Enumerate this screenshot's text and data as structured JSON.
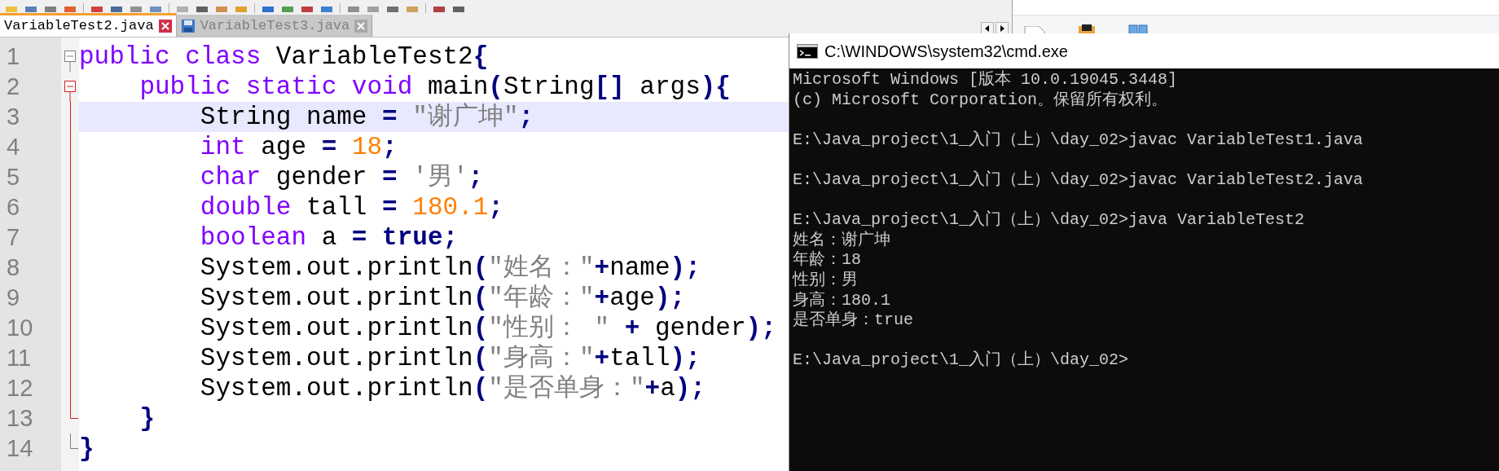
{
  "editor": {
    "tabs": [
      {
        "label": "VariableTest2.java",
        "selected": true
      },
      {
        "label": "VariableTest3.java",
        "selected": false
      }
    ],
    "lines": [
      {
        "number": "1",
        "kind": "fold_start",
        "current": false,
        "tokens": [
          {
            "kind": "keyword",
            "text": "public class"
          },
          {
            "kind": "plain",
            "text": " VariableTest2"
          },
          {
            "kind": "operator",
            "text": "{"
          }
        ]
      },
      {
        "number": "2",
        "kind": "fold_start_active",
        "current": false,
        "tokens": [
          {
            "kind": "keyword",
            "text": "    public static void"
          },
          {
            "kind": "plain",
            "text": " main"
          },
          {
            "kind": "operator",
            "text": "("
          },
          {
            "kind": "plain",
            "text": "String"
          },
          {
            "kind": "operator",
            "text": "[]"
          },
          {
            "kind": "plain",
            "text": " args"
          },
          {
            "kind": "operator",
            "text": "){"
          }
        ]
      },
      {
        "number": "3",
        "kind": "fold_body",
        "current": true,
        "tokens": [
          {
            "kind": "plain",
            "text": "        String name "
          },
          {
            "kind": "operator",
            "text": "= "
          },
          {
            "kind": "string",
            "text": "\"谢广坤\""
          },
          {
            "kind": "operator",
            "text": ";"
          }
        ]
      },
      {
        "number": "4",
        "kind": "fold_body",
        "current": false,
        "tokens": [
          {
            "kind": "keyword",
            "text": "        int"
          },
          {
            "kind": "plain",
            "text": " age "
          },
          {
            "kind": "operator",
            "text": "= "
          },
          {
            "kind": "number",
            "text": "18"
          },
          {
            "kind": "operator",
            "text": ";"
          }
        ]
      },
      {
        "number": "5",
        "kind": "fold_body",
        "current": false,
        "tokens": [
          {
            "kind": "keyword",
            "text": "        char"
          },
          {
            "kind": "plain",
            "text": " gender "
          },
          {
            "kind": "operator",
            "text": "= "
          },
          {
            "kind": "string",
            "text": "'男'"
          },
          {
            "kind": "operator",
            "text": ";"
          }
        ]
      },
      {
        "number": "6",
        "kind": "fold_body",
        "current": false,
        "tokens": [
          {
            "kind": "keyword",
            "text": "        double"
          },
          {
            "kind": "plain",
            "text": " tall "
          },
          {
            "kind": "operator",
            "text": "= "
          },
          {
            "kind": "number",
            "text": "180.1"
          },
          {
            "kind": "operator",
            "text": ";"
          }
        ]
      },
      {
        "number": "7",
        "kind": "fold_body",
        "current": false,
        "tokens": [
          {
            "kind": "keyword",
            "text": "        boolean"
          },
          {
            "kind": "plain",
            "text": " a "
          },
          {
            "kind": "operator",
            "text": "= "
          },
          {
            "kind": "literal",
            "text": "true"
          },
          {
            "kind": "operator",
            "text": ";"
          }
        ]
      },
      {
        "number": "8",
        "kind": "fold_body",
        "current": false,
        "tokens": [
          {
            "kind": "plain",
            "text": "        System.out.println"
          },
          {
            "kind": "operator",
            "text": "("
          },
          {
            "kind": "string",
            "text": "\"姓名：\""
          },
          {
            "kind": "operator",
            "text": "+"
          },
          {
            "kind": "plain",
            "text": "name"
          },
          {
            "kind": "operator",
            "text": ");"
          }
        ]
      },
      {
        "number": "9",
        "kind": "fold_body",
        "current": false,
        "tokens": [
          {
            "kind": "plain",
            "text": "        System.out.println"
          },
          {
            "kind": "operator",
            "text": "("
          },
          {
            "kind": "string",
            "text": "\"年龄：\""
          },
          {
            "kind": "operator",
            "text": "+"
          },
          {
            "kind": "plain",
            "text": "age"
          },
          {
            "kind": "operator",
            "text": ");"
          }
        ]
      },
      {
        "number": "10",
        "kind": "fold_body",
        "current": false,
        "tokens": [
          {
            "kind": "plain",
            "text": "        System.out.println"
          },
          {
            "kind": "operator",
            "text": "("
          },
          {
            "kind": "string",
            "text": "\"性别： \""
          },
          {
            "kind": "operator",
            "text": " +"
          },
          {
            "kind": "plain",
            "text": " gender"
          },
          {
            "kind": "operator",
            "text": ");"
          }
        ]
      },
      {
        "number": "11",
        "kind": "fold_body",
        "current": false,
        "tokens": [
          {
            "kind": "plain",
            "text": "        System.out.println"
          },
          {
            "kind": "operator",
            "text": "("
          },
          {
            "kind": "string",
            "text": "\"身高：\""
          },
          {
            "kind": "operator",
            "text": "+"
          },
          {
            "kind": "plain",
            "text": "tall"
          },
          {
            "kind": "operator",
            "text": ");"
          }
        ]
      },
      {
        "number": "12",
        "kind": "fold_body",
        "current": false,
        "tokens": [
          {
            "kind": "plain",
            "text": "        System.out.println"
          },
          {
            "kind": "operator",
            "text": "("
          },
          {
            "kind": "string",
            "text": "\"是否单身：\""
          },
          {
            "kind": "operator",
            "text": "+"
          },
          {
            "kind": "plain",
            "text": "a"
          },
          {
            "kind": "operator",
            "text": ");"
          }
        ]
      },
      {
        "number": "13",
        "kind": "fold_end_active",
        "current": false,
        "tokens": [
          {
            "kind": "operator",
            "text": "    }"
          }
        ]
      },
      {
        "number": "14",
        "kind": "fold_end",
        "current": false,
        "tokens": [
          {
            "kind": "operator",
            "text": "}"
          }
        ]
      }
    ]
  },
  "console": {
    "title": "C:\\WINDOWS\\system32\\cmd.exe",
    "blocks": [
      [
        "Microsoft Windows [版本 10.0.19045.3448]",
        "(c) Microsoft Corporation。保留所有权利。"
      ],
      [
        "E:\\Java_project\\1_入门（上）\\day_02>javac VariableTest1.java"
      ],
      [
        "E:\\Java_project\\1_入门（上）\\day_02>javac VariableTest2.java"
      ],
      [
        "E:\\Java_project\\1_入门（上）\\day_02>java VariableTest2",
        "姓名：谢广坤",
        "年龄：18",
        "性别：男",
        "身高：180.1",
        "是否单身：true"
      ],
      [
        "E:\\Java_project\\1_入门（上）\\day_02>"
      ]
    ]
  }
}
